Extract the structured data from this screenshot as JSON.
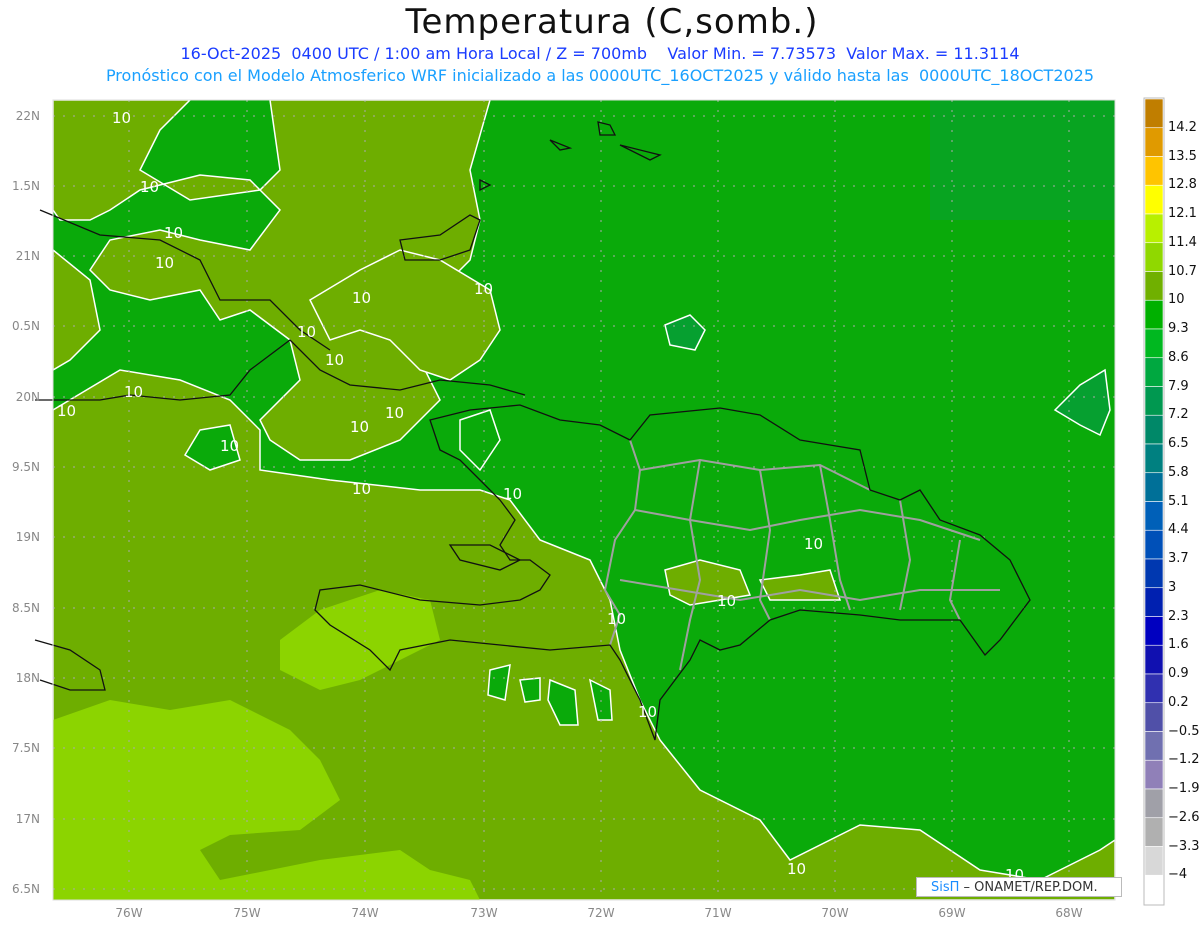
{
  "header": {
    "title": "Temperatura (C,somb.)",
    "line1": "16-Oct-2025  0400 UTC / 1:00 am Hora Local / Z = 700mb    Valor Min. = 7.73573  Valor Max. = 11.3114",
    "line2": "Pronóstico con el Modelo Atmosferico WRF inicializado a las 0000UTC_16OCT2025 y válido hasta las  0000UTC_18OCT2025"
  },
  "axes": {
    "lat_labels": [
      "22N",
      "1.5N",
      "21N",
      "0.5N",
      "20N",
      "9.5N",
      "19N",
      "8.5N",
      "18N",
      "7.5N",
      "17N",
      "6.5N"
    ],
    "lon_labels": [
      "76W",
      "75W",
      "74W",
      "73W",
      "72W",
      "71W",
      "70W",
      "69W",
      "68W"
    ]
  },
  "contour_label": "10",
  "colorbar": {
    "labels": [
      "14.2",
      "13.5",
      "12.8",
      "12.1",
      "11.4",
      "10.7",
      "10",
      "9.3",
      "8.6",
      "7.9",
      "7.2",
      "6.5",
      "5.8",
      "5.1",
      "4.4",
      "3.7",
      "3",
      "2.3",
      "1.6",
      "0.9",
      "0.2",
      "−0.5",
      "−1.2",
      "−1.9",
      "−2.6",
      "−3.3",
      "−4"
    ],
    "colors": [
      "#c07e00",
      "#e09a00",
      "#ffc400",
      "#ffff00",
      "#b8f000",
      "#90d800",
      "#70b000",
      "#00b000",
      "#00b820",
      "#00a840",
      "#009850",
      "#008868",
      "#008080",
      "#007098",
      "#0060b8",
      "#0050b8",
      "#0038b0",
      "#0020b0",
      "#0000c0",
      "#1010b0",
      "#3030b0",
      "#5050a8",
      "#7070b0",
      "#9080b8",
      "#a0a0a8",
      "#b0b0b0",
      "#d8d8d8",
      "#ffffff"
    ]
  },
  "colors": {
    "dark_green": "#0aaa0a",
    "olive": "#6eae00",
    "light_green": "#8cd400"
  },
  "credit": {
    "brand": "SisΠ",
    "text": " – ONAMET/REP.DOM."
  }
}
